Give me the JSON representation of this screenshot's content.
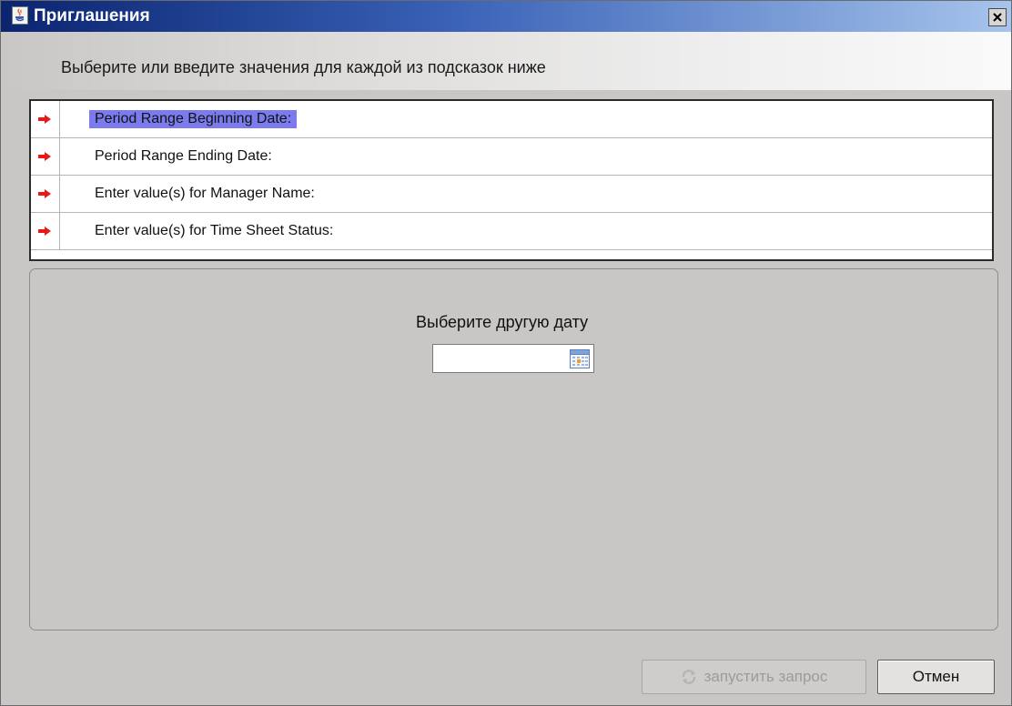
{
  "window": {
    "title": "Приглашения",
    "app_icon": "java-coffee-icon",
    "close_icon": "close-icon"
  },
  "instruction": "Выберите или введите значения для каждой из подсказок ниже",
  "prompts": [
    {
      "label": "Period Range Beginning Date:",
      "selected": true,
      "indicator": "red-arrow-icon"
    },
    {
      "label": "Period Range Ending Date:",
      "selected": false,
      "indicator": "red-arrow-icon"
    },
    {
      "label": "Enter value(s) for Manager Name:",
      "selected": false,
      "indicator": "red-arrow-icon"
    },
    {
      "label": "Enter value(s) for Time Sheet Status:",
      "selected": false,
      "indicator": "red-arrow-icon"
    }
  ],
  "date_panel": {
    "caption": "Выберите другую дату",
    "value": "",
    "picker_icon": "calendar-icon"
  },
  "buttons": {
    "run_label": "запустить запрос",
    "run_enabled": false,
    "run_icon": "refresh-icon",
    "cancel_label": "Отмен"
  },
  "colors": {
    "selection": "#7b7bee",
    "indicator": "#e81818",
    "title_gradient_start": "#0a2470",
    "title_gradient_end": "#a6c4ec"
  }
}
